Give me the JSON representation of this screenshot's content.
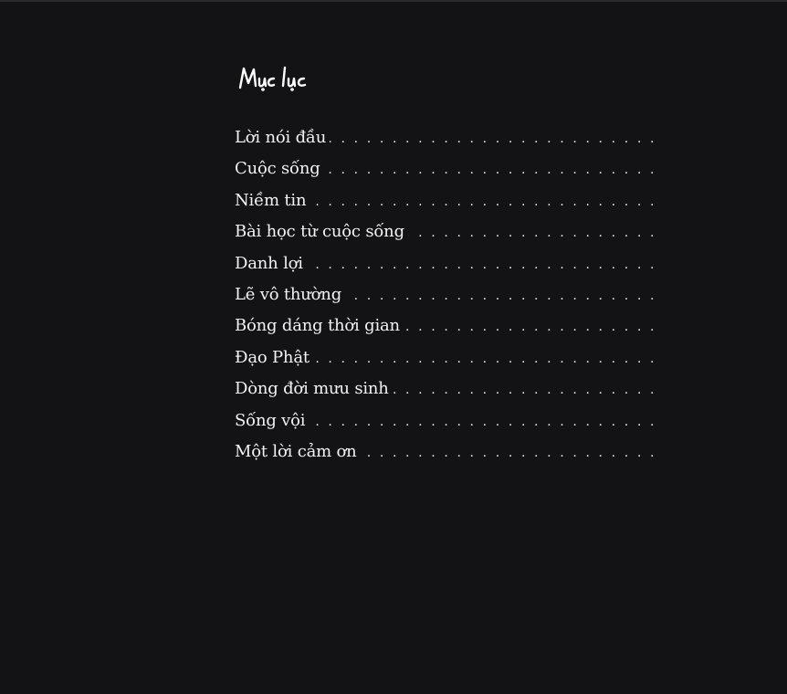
{
  "title": "Mục lục",
  "toc": {
    "items": [
      {
        "label": "Lời nói đầu"
      },
      {
        "label": "Cuộc sống"
      },
      {
        "label": "Niềm tin"
      },
      {
        "label": "Bài học từ cuộc sống"
      },
      {
        "label": "Danh lợi"
      },
      {
        "label": "Lẽ vô thường"
      },
      {
        "label": "Bóng dáng thời gian"
      },
      {
        "label": "Đạo Phật"
      },
      {
        "label": "Dòng đời mưu sinh"
      },
      {
        "label": "Sống vội"
      },
      {
        "label": "Một lời cảm ơn"
      }
    ]
  },
  "colors": {
    "background": "#131315",
    "text": "#f2f2f2"
  }
}
